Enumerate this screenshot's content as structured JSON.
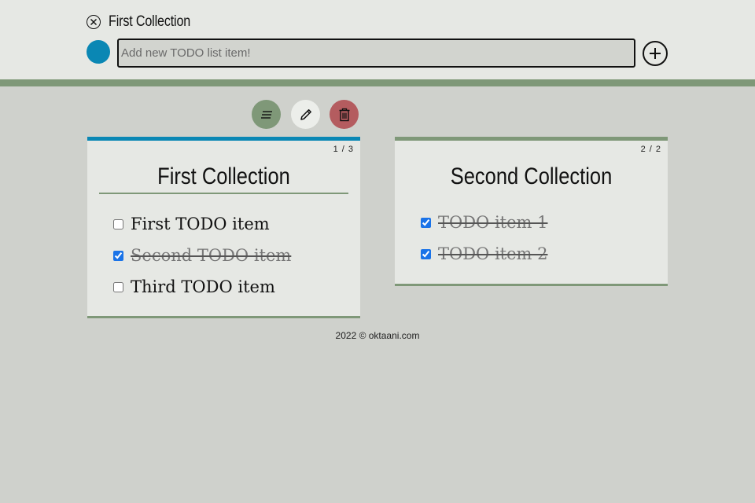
{
  "header": {
    "current_collection": "First Collection",
    "add_input": {
      "placeholder": "Add new TODO list item!",
      "value": ""
    },
    "color_dot": "#0a87b4"
  },
  "toolbar": {
    "buttons": [
      {
        "name": "sort",
        "icon": "lines-icon",
        "color": "#7f9878"
      },
      {
        "name": "edit",
        "icon": "pencil-icon",
        "color": "#eceeea"
      },
      {
        "name": "delete",
        "icon": "trash-icon",
        "color": "#b45c5f"
      }
    ]
  },
  "collections": [
    {
      "title": "First Collection",
      "count": "1 / 3",
      "accent": "#0a87b4",
      "items": [
        {
          "text": "First TODO item",
          "done": false
        },
        {
          "text": "Second TODO item",
          "done": true
        },
        {
          "text": "Third TODO item",
          "done": false
        }
      ]
    },
    {
      "title": "Second Collection",
      "count": "2 / 2",
      "accent": "#7f9878",
      "items": [
        {
          "text": "TODO item 1",
          "done": true
        },
        {
          "text": "TODO item 2",
          "done": true
        }
      ]
    }
  ],
  "footer": {
    "text": "2022 © oktaani.com"
  }
}
